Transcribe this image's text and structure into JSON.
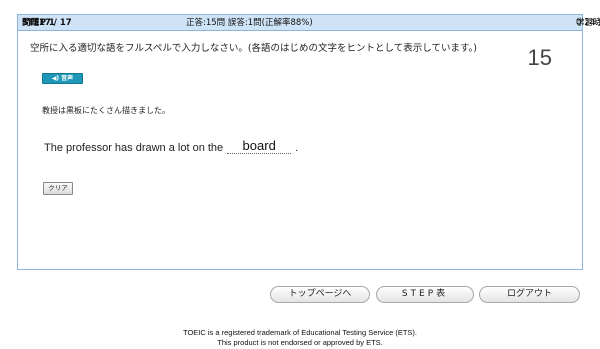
{
  "header": {
    "step_label": "STEP 1",
    "question_label": "問題17 / 17",
    "score_text": "正答:15問  誤答:1問(正解率88%)",
    "time_label": "学習時間",
    "time_value": "0:24:51"
  },
  "question": {
    "instruction": "空所に入る適切な語をフルスペルで入力しなさい。(各語のはじめの文字をヒントとして表示しています。)",
    "counter": "15",
    "audio_button_label": "音声",
    "audio_icon": "speaker-icon",
    "japanese_sentence": "教授は黒板にたくさん描きました。",
    "sentence_before": "The professor has drawn a lot on the",
    "answer_value": "board",
    "sentence_after": ".",
    "clear_button_label": "クリア"
  },
  "nav": {
    "top_page_label": "トップページへ",
    "step_table_label": "STEP表",
    "logout_label": "ログアウト"
  },
  "footer": {
    "line1": "TOEIC is a registered trademark of Educational Testing Service (ETS).",
    "line2": "This product is not endorsed or approved by ETS."
  },
  "colors": {
    "header_bg": "#cfe3f6",
    "panel_border": "#8fb3d9",
    "audio_button": "#1f97b8"
  }
}
